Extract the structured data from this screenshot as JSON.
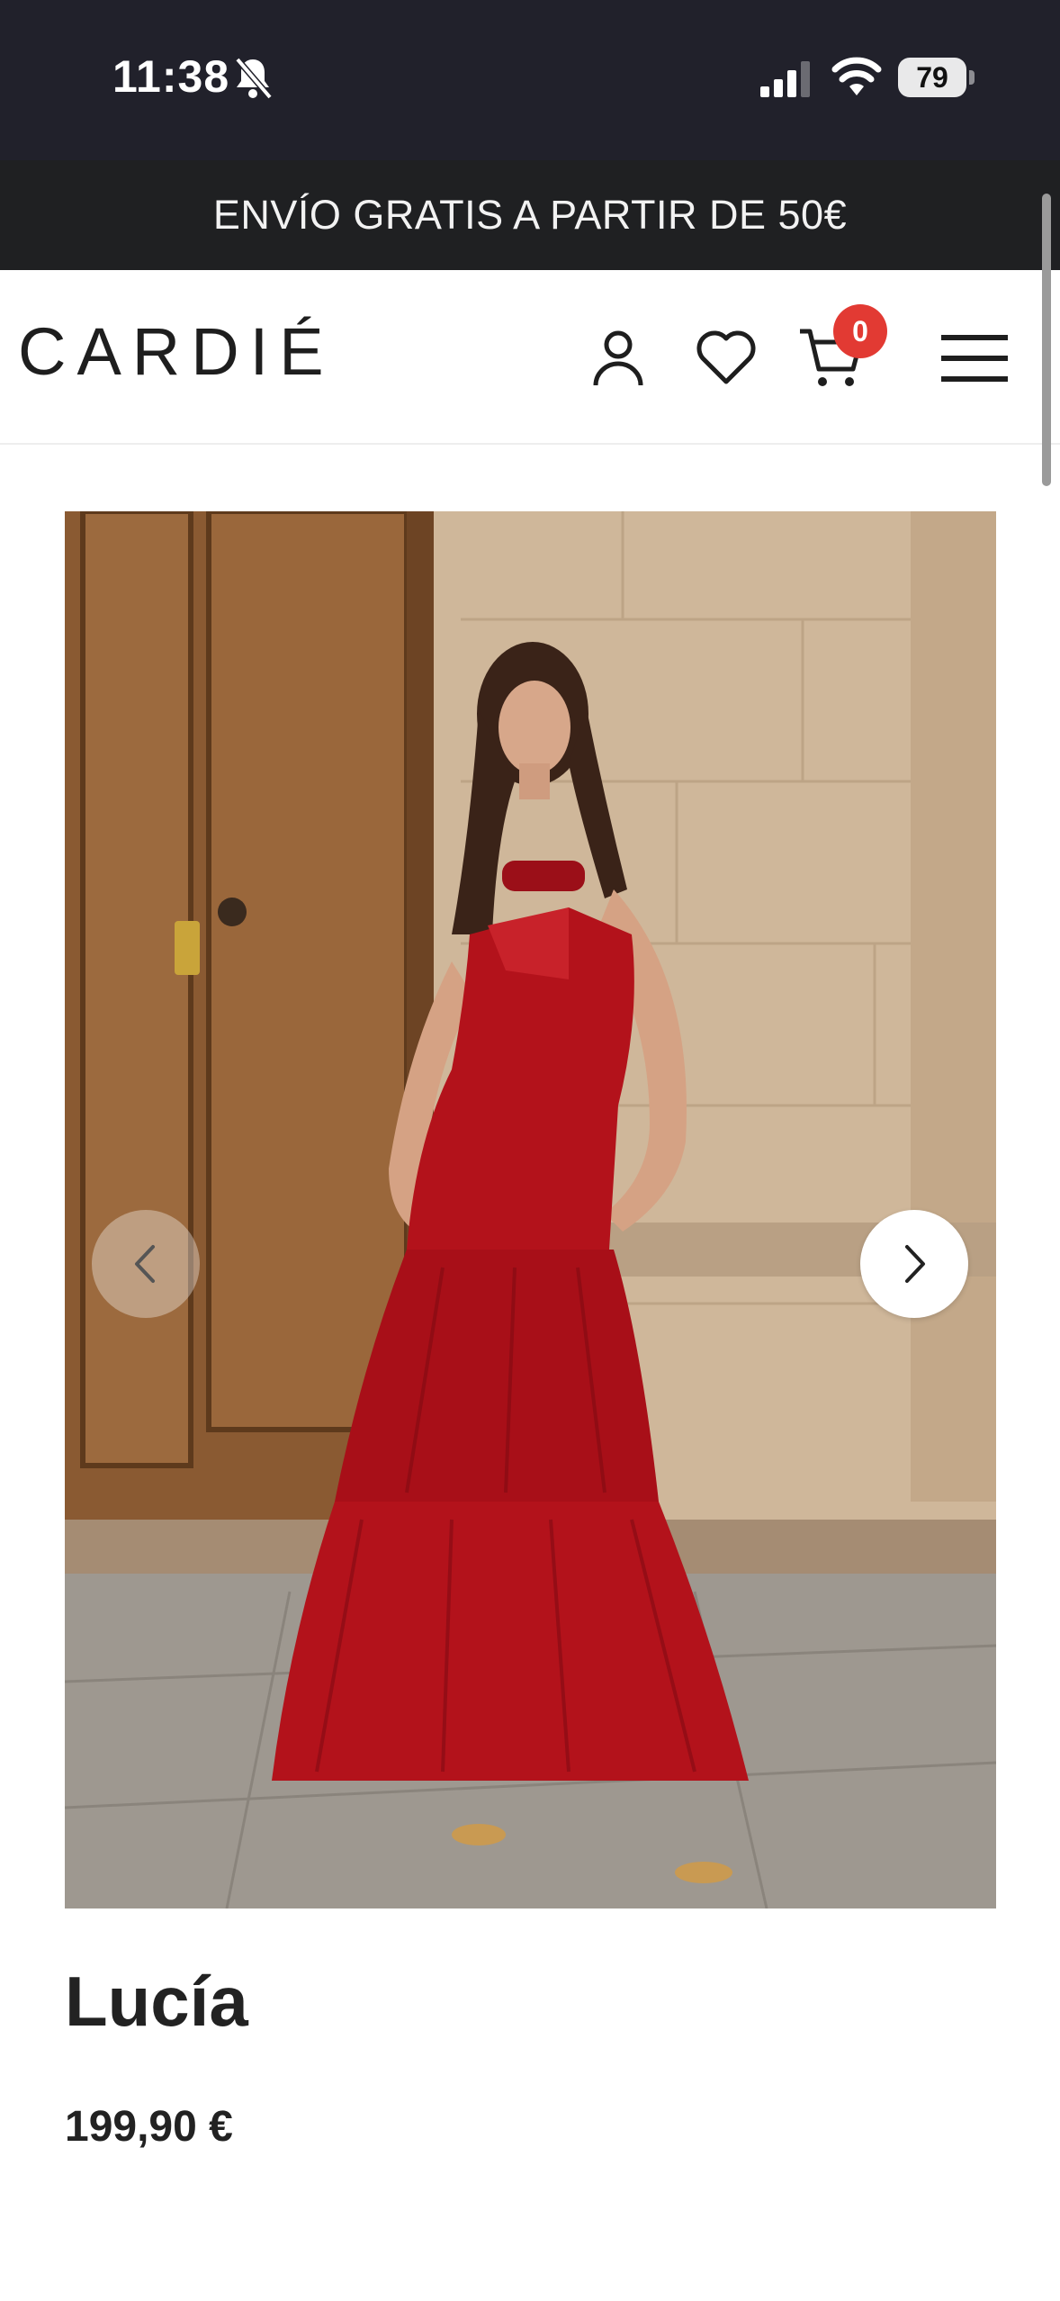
{
  "status_bar": {
    "time": "11:38",
    "battery": "79",
    "icons": [
      "bell-slash-icon",
      "cellular-signal-icon",
      "wifi-icon",
      "battery-icon"
    ]
  },
  "promo": {
    "text": "ENVÍO GRATIS A PARTIR DE 50€"
  },
  "header": {
    "logo": "CARDIÉ",
    "cart_count": "0",
    "icons": [
      "account-icon",
      "heart-icon",
      "cart-icon",
      "menu-icon"
    ]
  },
  "gallery": {
    "prev_icon": "chevron-left-icon",
    "next_icon": "chevron-right-icon",
    "image": "model-in-red-dress"
  },
  "product": {
    "name": "Lucía",
    "price": "199,90 €"
  },
  "colors": {
    "status_bg": "#21212b",
    "promo_bg": "#1f2022",
    "badge": "#e23a33",
    "dress": "#b3121b"
  }
}
